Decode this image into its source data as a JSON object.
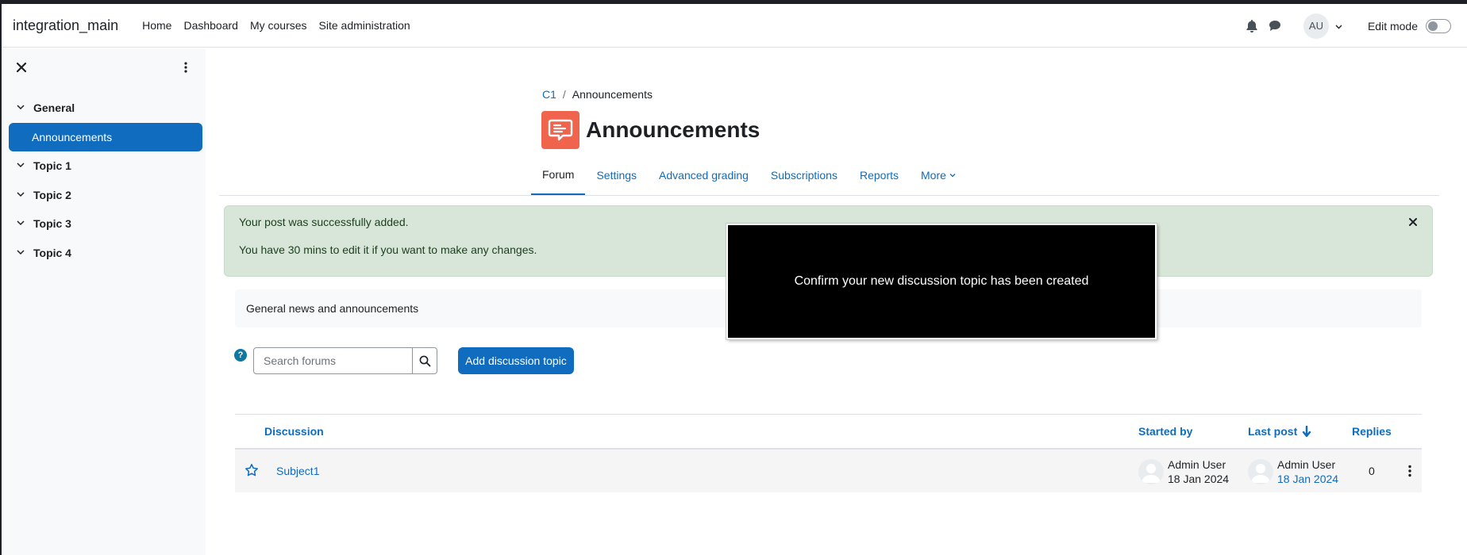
{
  "navbar": {
    "site_name": "integration_main",
    "links": [
      "Home",
      "Dashboard",
      "My courses",
      "Site administration"
    ],
    "avatar_initials": "AU",
    "edit_mode_label": "Edit mode"
  },
  "drawer": {
    "sections": [
      "General",
      "Topic 1",
      "Topic 2",
      "Topic 3",
      "Topic 4"
    ],
    "active_item": "Announcements"
  },
  "breadcrumb": {
    "course": "C1",
    "current": "Announcements"
  },
  "page": {
    "title": "Announcements"
  },
  "tabs": [
    "Forum",
    "Settings",
    "Advanced grading",
    "Subscriptions",
    "Reports",
    "More"
  ],
  "alert": {
    "line1": "Your post was successfully added.",
    "line2": "You have 30 mins to edit it if you want to make any changes."
  },
  "intro": "General news and announcements",
  "search": {
    "placeholder": "Search forums"
  },
  "add_button": "Add discussion topic",
  "help_icon": "?",
  "table": {
    "headers": {
      "discussion": "Discussion",
      "started_by": "Started by",
      "last_post": "Last post",
      "replies": "Replies"
    },
    "rows": [
      {
        "subject": "Subject1",
        "started_by_name": "Admin User",
        "started_by_date": "18 Jan 2024",
        "last_post_name": "Admin User",
        "last_post_date": "18 Jan 2024",
        "replies": "0"
      }
    ]
  },
  "toast": "Confirm your new discussion topic has been created",
  "colors": {
    "primary": "#0f6cbf",
    "forum_icon": "#f0634c",
    "success_bg": "#d7e6d8"
  }
}
